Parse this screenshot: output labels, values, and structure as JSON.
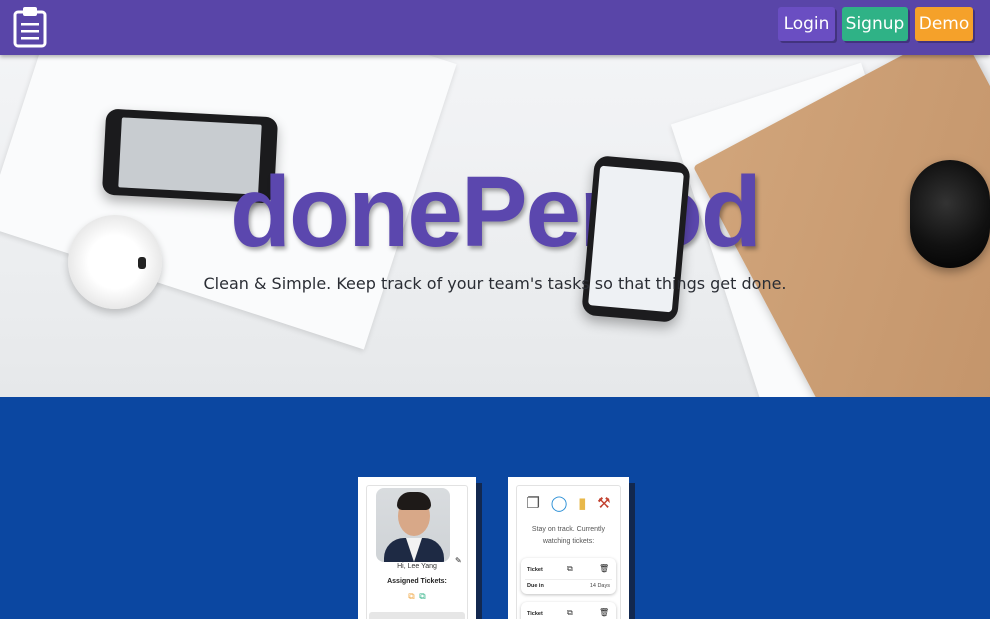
{
  "navbar": {
    "logo_icon": "clipboard-icon",
    "buttons": {
      "login": "Login",
      "signup": "Signup",
      "demo": "Demo"
    },
    "colors": {
      "bar": "#5945a8",
      "login": "#6a4ec2",
      "signup": "#2fb286",
      "demo": "#f5a12a"
    }
  },
  "hero": {
    "title": "donePeriod",
    "subtitle": "Clean & Simple. Keep track of your team's tasks so that things get done.",
    "title_color": "#5b47ae"
  },
  "section": {
    "background": "#0b47a1"
  },
  "profile_card": {
    "greeting": "Hi, Lee Yang",
    "assigned_label": "Assigned Tickets:",
    "icons": [
      "external-link-icon",
      "edit-icon",
      "pencil-icon"
    ]
  },
  "track_card": {
    "icons": [
      "copy-icon",
      "compass-icon",
      "folder-icon",
      "wrench-icon"
    ],
    "message": "Stay on track. Currently watching tickets:",
    "tickets": [
      {
        "label": "Ticket",
        "due_label": "Due in",
        "due_value": "14 Days"
      },
      {
        "label": "Ticket"
      }
    ]
  }
}
